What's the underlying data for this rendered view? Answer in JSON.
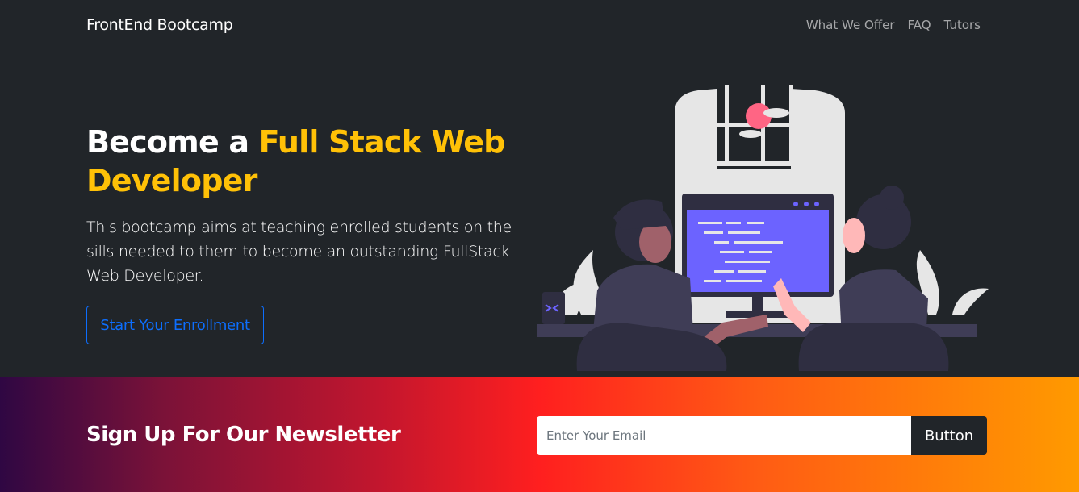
{
  "navbar": {
    "brand": "FrontEnd Bootcamp",
    "links": [
      {
        "label": "What We Offer"
      },
      {
        "label": "FAQ"
      },
      {
        "label": "Tutors"
      }
    ]
  },
  "hero": {
    "title_plain": "Become a ",
    "title_accent": "Full Stack Web Developer",
    "lead": "This bootcamp aims at teaching enrolled students on the sills needed to them to become an outstanding FullStack Web Developer.",
    "cta_label": "Start Your Enrollment"
  },
  "newsletter": {
    "title": "Sign Up For Our Newsletter",
    "email_placeholder": "Enter Your Email",
    "email_value": "",
    "button_label": "Button"
  },
  "colors": {
    "background": "#212529",
    "accent": "#ffc107",
    "primary": "#0d6efd",
    "illustration_purple": "#6c63ff",
    "illustration_dark": "#2f2e41",
    "illustration_light": "#e6e6e6"
  },
  "icons": {
    "hero_illustration": "two-developers-at-computer-illustration"
  }
}
